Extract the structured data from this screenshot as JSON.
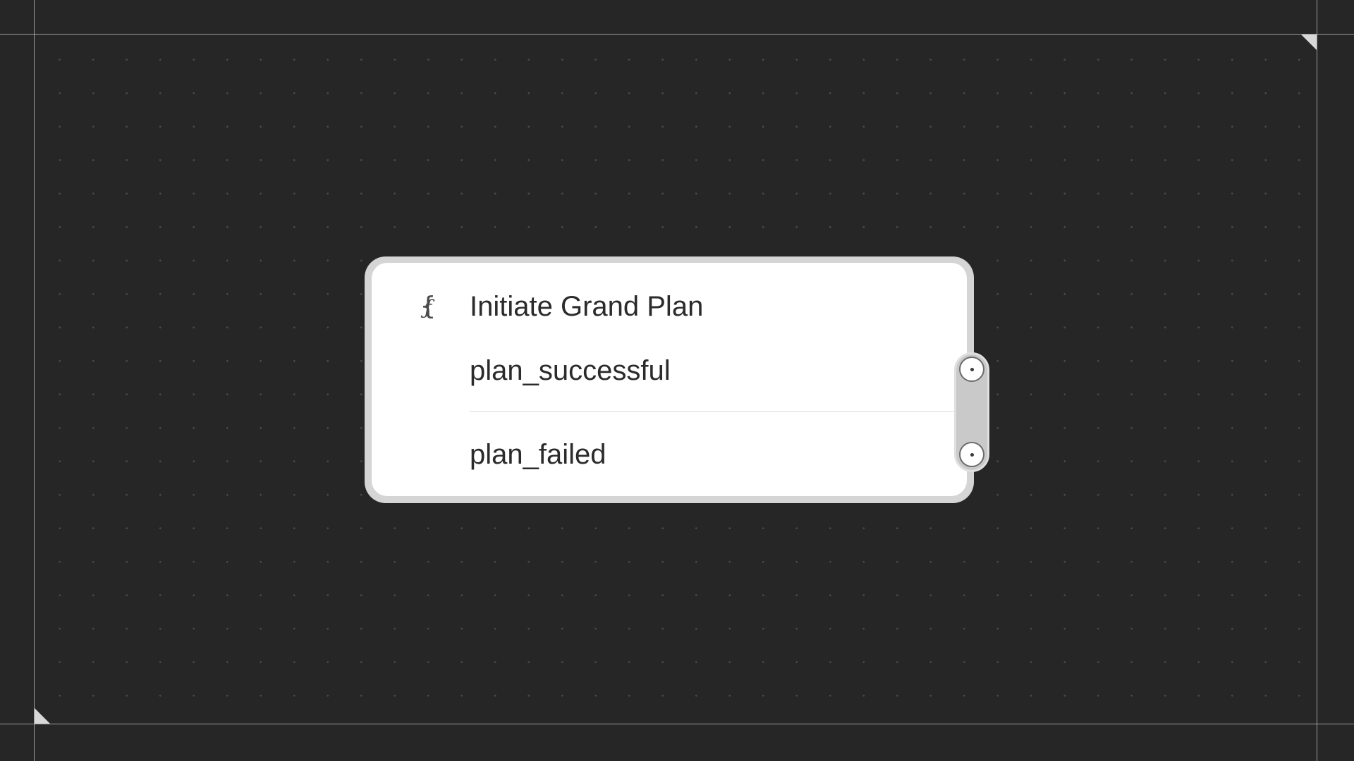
{
  "colors": {
    "background": "#262626",
    "node_border": "#d5d5d5",
    "node_fill": "#ffffff",
    "text": "#2b2b2b",
    "port_rail": "#c9c9c9"
  },
  "node": {
    "icon": "function-braces-icon",
    "title": "Initiate Grand Plan",
    "outputs": [
      {
        "label": "plan_successful"
      },
      {
        "label": "plan_failed"
      }
    ]
  }
}
